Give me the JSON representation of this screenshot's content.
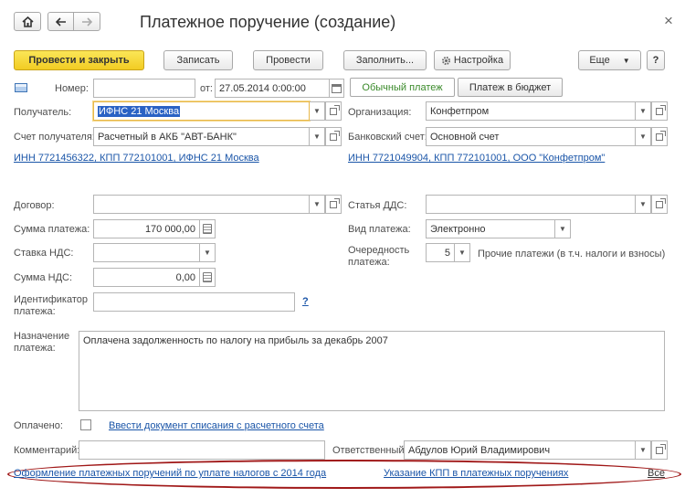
{
  "window": {
    "title": "Платежное поручение (создание)",
    "close_glyph": "×",
    "nav": {
      "home_icon": "home-icon",
      "back_icon": "arrow-left-icon",
      "forward_icon": "arrow-right-icon"
    }
  },
  "toolbar": {
    "post_and_close": "Провести и закрыть",
    "save": "Записать",
    "post": "Провести",
    "fill": "Заполнить...",
    "settings": "Настройка",
    "more": "Еще",
    "help": "?"
  },
  "header": {
    "number_label": "Номер:",
    "number_value": "",
    "date_label": "от:",
    "date_value": "27.05.2014  0:00:00",
    "tab_regular": "Обычный платеж",
    "tab_budget": "Платеж в бюджет"
  },
  "fields": {
    "recipient_label": "Получатель:",
    "recipient_value": "ИФНС 21 Москва",
    "organization_label": "Организация:",
    "organization_value": "Конфетпром",
    "recipient_account_label": "Счет получателя:",
    "recipient_account_value": "Расчетный в АКБ \"АВТ-БАНК\"",
    "bank_account_label": "Банковский счет:",
    "bank_account_value": "Основной счет",
    "recipient_info_link": "ИНН 7721456322, КПП 772101001, ИФНС 21 Москва",
    "organization_info_link": "ИНН 7721049904, КПП 772101001, ООО \"Конфетпром\"",
    "contract_label": "Договор:",
    "contract_value": "",
    "cashflow_label": "Статья ДДС:",
    "cashflow_value": "",
    "amount_label": "Сумма платежа:",
    "amount_value": "170 000,00",
    "payment_type_label": "Вид платежа:",
    "payment_type_value": "Электронно",
    "vat_rate_label": "Ставка НДС:",
    "vat_rate_value": "",
    "priority_label_1": "Очередность",
    "priority_label_2": "платежа:",
    "priority_value": "5",
    "priority_desc": "Прочие платежи (в т.ч. налоги и взносы)",
    "vat_amount_label": "Сумма НДС:",
    "vat_amount_value": "0,00",
    "payment_id_label_1": "Идентификатор",
    "payment_id_label_2": "платежа:",
    "payment_id_value": "",
    "payment_id_help": "?",
    "purpose_label_1": "Назначение",
    "purpose_label_2": "платежа:",
    "purpose_value": "Оплачена задолженность по налогу на прибыль за декабрь 2007",
    "paid_label": "Оплачено:",
    "paid_checked": false,
    "write_off_link": "Ввести документ списания с расчетного счета",
    "comment_label": "Комментарий:",
    "comment_value": "",
    "responsible_label": "Ответственный:",
    "responsible_value": "Абдулов Юрий Владимирович"
  },
  "footer": {
    "link_taxes_2014": "Оформление платежных поручений по уплате налогов с 2014 года",
    "link_kpp": "Указание КПП в платежных поручениях",
    "link_all": "Все",
    "highlight_color": "#a01818"
  }
}
